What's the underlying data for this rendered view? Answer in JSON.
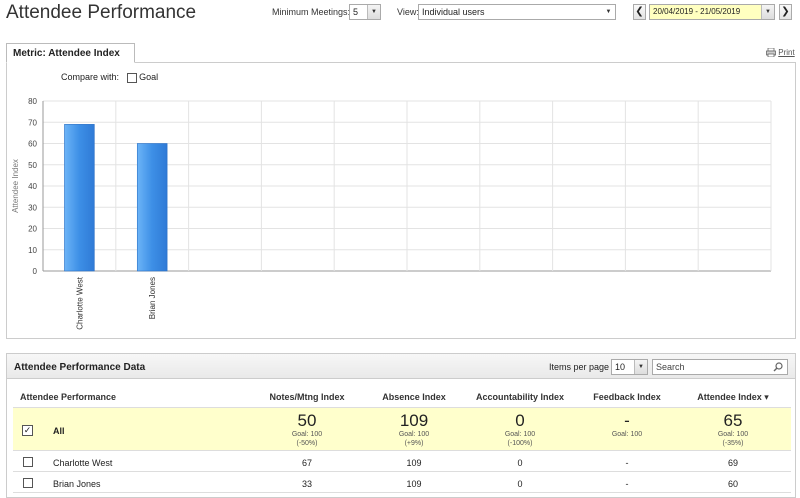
{
  "header": {
    "title": "Attendee Performance",
    "min_meetings_label": "Minimum Meetings:",
    "min_meetings_value": "5",
    "view_label": "View:",
    "view_value": "Individual users",
    "date_range": "20/04/2019 - 21/05/2019",
    "prev_icon": "chevron-left-icon",
    "next_icon": "chevron-right-icon"
  },
  "metric_panel": {
    "tab_label": "Metric: Attendee Index",
    "print_label": "Print",
    "compare_label": "Compare with:",
    "goal_label": "Goal"
  },
  "chart_data": {
    "type": "bar",
    "categories": [
      "Charlotte West",
      "Brian Jones"
    ],
    "values": [
      69,
      60
    ],
    "ylabel": "Attendee Index",
    "xlabel": "",
    "ylim": [
      0,
      80
    ],
    "yticks": [
      0,
      10,
      20,
      30,
      40,
      50,
      60,
      70,
      80
    ],
    "grid": true,
    "color": "#3d8fe6"
  },
  "data_panel": {
    "title": "Attendee Performance Data",
    "items_per_page_label": "Items per page",
    "items_per_page_value": "10",
    "search_placeholder": "Search",
    "columns": [
      "Attendee Performance",
      "Notes/Mtng Index",
      "Absence Index",
      "Accountability Index",
      "Feedback Index",
      "Attendee Index ▾"
    ],
    "all_row": {
      "label": "All",
      "cells": [
        {
          "value": "50",
          "goal": "Goal: 100",
          "delta": "(-50%)"
        },
        {
          "value": "109",
          "goal": "Goal: 100",
          "delta": "(+9%)"
        },
        {
          "value": "0",
          "goal": "Goal: 100",
          "delta": "(-100%)"
        },
        {
          "value": "-",
          "goal": "Goal: 100",
          "delta": ""
        },
        {
          "value": "65",
          "goal": "Goal: 100",
          "delta": "(-35%)"
        }
      ]
    },
    "rows": [
      {
        "name": "Charlotte West",
        "cells": [
          "67",
          "109",
          "0",
          "-",
          "69"
        ]
      },
      {
        "name": "Brian Jones",
        "cells": [
          "33",
          "109",
          "0",
          "-",
          "60"
        ]
      }
    ]
  }
}
